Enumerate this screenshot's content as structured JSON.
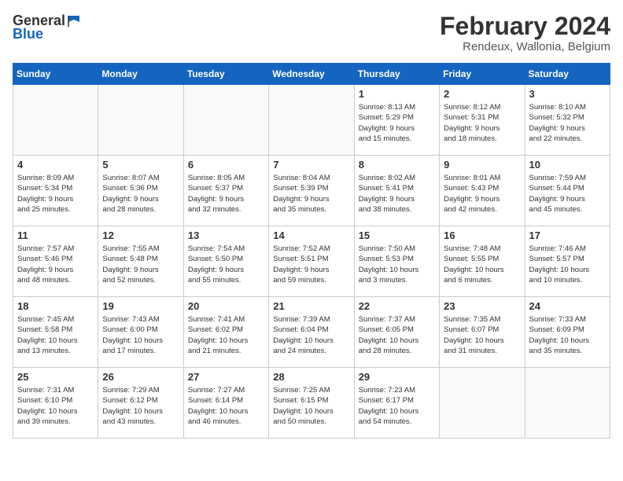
{
  "logo": {
    "text_general": "General",
    "text_blue": "Blue"
  },
  "title": "February 2024",
  "location": "Rendeux, Wallonia, Belgium",
  "headers": [
    "Sunday",
    "Monday",
    "Tuesday",
    "Wednesday",
    "Thursday",
    "Friday",
    "Saturday"
  ],
  "weeks": [
    [
      {
        "day": "",
        "info": ""
      },
      {
        "day": "",
        "info": ""
      },
      {
        "day": "",
        "info": ""
      },
      {
        "day": "",
        "info": ""
      },
      {
        "day": "1",
        "info": "Sunrise: 8:13 AM\nSunset: 5:29 PM\nDaylight: 9 hours\nand 15 minutes."
      },
      {
        "day": "2",
        "info": "Sunrise: 8:12 AM\nSunset: 5:31 PM\nDaylight: 9 hours\nand 18 minutes."
      },
      {
        "day": "3",
        "info": "Sunrise: 8:10 AM\nSunset: 5:32 PM\nDaylight: 9 hours\nand 22 minutes."
      }
    ],
    [
      {
        "day": "4",
        "info": "Sunrise: 8:09 AM\nSunset: 5:34 PM\nDaylight: 9 hours\nand 25 minutes."
      },
      {
        "day": "5",
        "info": "Sunrise: 8:07 AM\nSunset: 5:36 PM\nDaylight: 9 hours\nand 28 minutes."
      },
      {
        "day": "6",
        "info": "Sunrise: 8:05 AM\nSunset: 5:37 PM\nDaylight: 9 hours\nand 32 minutes."
      },
      {
        "day": "7",
        "info": "Sunrise: 8:04 AM\nSunset: 5:39 PM\nDaylight: 9 hours\nand 35 minutes."
      },
      {
        "day": "8",
        "info": "Sunrise: 8:02 AM\nSunset: 5:41 PM\nDaylight: 9 hours\nand 38 minutes."
      },
      {
        "day": "9",
        "info": "Sunrise: 8:01 AM\nSunset: 5:43 PM\nDaylight: 9 hours\nand 42 minutes."
      },
      {
        "day": "10",
        "info": "Sunrise: 7:59 AM\nSunset: 5:44 PM\nDaylight: 9 hours\nand 45 minutes."
      }
    ],
    [
      {
        "day": "11",
        "info": "Sunrise: 7:57 AM\nSunset: 5:46 PM\nDaylight: 9 hours\nand 48 minutes."
      },
      {
        "day": "12",
        "info": "Sunrise: 7:55 AM\nSunset: 5:48 PM\nDaylight: 9 hours\nand 52 minutes."
      },
      {
        "day": "13",
        "info": "Sunrise: 7:54 AM\nSunset: 5:50 PM\nDaylight: 9 hours\nand 55 minutes."
      },
      {
        "day": "14",
        "info": "Sunrise: 7:52 AM\nSunset: 5:51 PM\nDaylight: 9 hours\nand 59 minutes."
      },
      {
        "day": "15",
        "info": "Sunrise: 7:50 AM\nSunset: 5:53 PM\nDaylight: 10 hours\nand 3 minutes."
      },
      {
        "day": "16",
        "info": "Sunrise: 7:48 AM\nSunset: 5:55 PM\nDaylight: 10 hours\nand 6 minutes."
      },
      {
        "day": "17",
        "info": "Sunrise: 7:46 AM\nSunset: 5:57 PM\nDaylight: 10 hours\nand 10 minutes."
      }
    ],
    [
      {
        "day": "18",
        "info": "Sunrise: 7:45 AM\nSunset: 5:58 PM\nDaylight: 10 hours\nand 13 minutes."
      },
      {
        "day": "19",
        "info": "Sunrise: 7:43 AM\nSunset: 6:00 PM\nDaylight: 10 hours\nand 17 minutes."
      },
      {
        "day": "20",
        "info": "Sunrise: 7:41 AM\nSunset: 6:02 PM\nDaylight: 10 hours\nand 21 minutes."
      },
      {
        "day": "21",
        "info": "Sunrise: 7:39 AM\nSunset: 6:04 PM\nDaylight: 10 hours\nand 24 minutes."
      },
      {
        "day": "22",
        "info": "Sunrise: 7:37 AM\nSunset: 6:05 PM\nDaylight: 10 hours\nand 28 minutes."
      },
      {
        "day": "23",
        "info": "Sunrise: 7:35 AM\nSunset: 6:07 PM\nDaylight: 10 hours\nand 31 minutes."
      },
      {
        "day": "24",
        "info": "Sunrise: 7:33 AM\nSunset: 6:09 PM\nDaylight: 10 hours\nand 35 minutes."
      }
    ],
    [
      {
        "day": "25",
        "info": "Sunrise: 7:31 AM\nSunset: 6:10 PM\nDaylight: 10 hours\nand 39 minutes."
      },
      {
        "day": "26",
        "info": "Sunrise: 7:29 AM\nSunset: 6:12 PM\nDaylight: 10 hours\nand 43 minutes."
      },
      {
        "day": "27",
        "info": "Sunrise: 7:27 AM\nSunset: 6:14 PM\nDaylight: 10 hours\nand 46 minutes."
      },
      {
        "day": "28",
        "info": "Sunrise: 7:25 AM\nSunset: 6:15 PM\nDaylight: 10 hours\nand 50 minutes."
      },
      {
        "day": "29",
        "info": "Sunrise: 7:23 AM\nSunset: 6:17 PM\nDaylight: 10 hours\nand 54 minutes."
      },
      {
        "day": "",
        "info": ""
      },
      {
        "day": "",
        "info": ""
      }
    ]
  ]
}
